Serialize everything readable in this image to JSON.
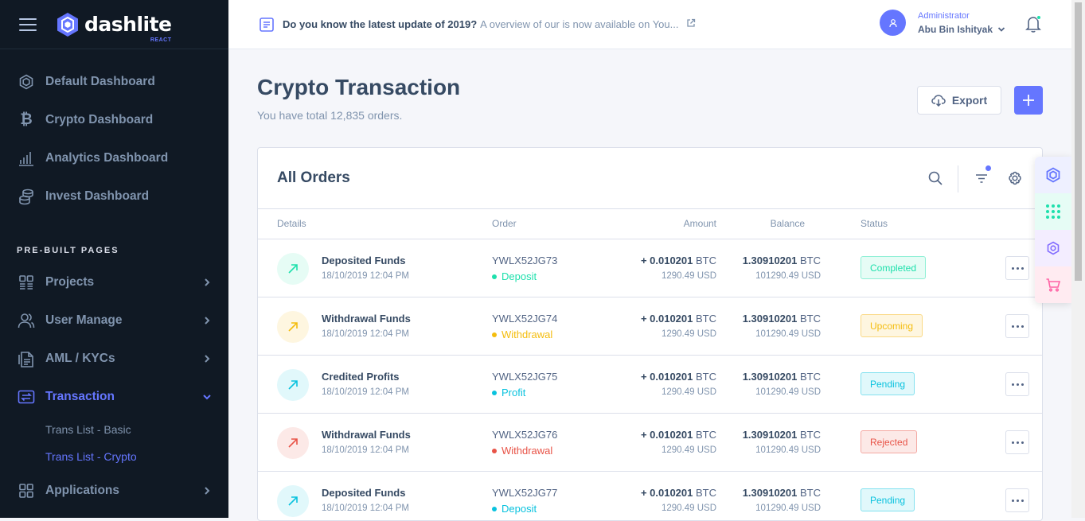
{
  "brand": {
    "name": "dashlite",
    "sub": "REACT"
  },
  "sidebar": {
    "items": [
      {
        "label": "Default Dashboard"
      },
      {
        "label": "Crypto Dashboard"
      },
      {
        "label": "Analytics Dashboard"
      },
      {
        "label": "Invest Dashboard"
      }
    ],
    "heading": "PRE-BUILT PAGES",
    "pages": [
      {
        "label": "Projects"
      },
      {
        "label": "User Manage"
      },
      {
        "label": "AML / KYCs"
      },
      {
        "label": "Transaction"
      },
      {
        "label": "Applications"
      }
    ],
    "sub": [
      {
        "label": "Trans List - Basic"
      },
      {
        "label": "Trans List - Crypto"
      }
    ]
  },
  "header": {
    "news_bold": "Do you know the latest update of 2019?",
    "news_rest": "A overview of our is now available on You...",
    "user_role": "Administrator",
    "user_name": "Abu Bin Ishityak"
  },
  "page": {
    "title": "Crypto Transaction",
    "subtitle": "You have total 12,835 orders.",
    "export_label": "Export"
  },
  "orders": {
    "title": "All Orders",
    "columns": {
      "details": "Details",
      "order": "Order",
      "amount": "Amount",
      "balance": "Balance",
      "status": "Status"
    },
    "rows": [
      {
        "name": "Deposited Funds",
        "date": "18/10/2019 12:04 PM",
        "order": "YWLX52JG73",
        "type": "Deposit",
        "type_color": "#1ee0ac",
        "amount": "+ 0.010201",
        "amount_cur": "BTC",
        "amount_usd": "1290.49 USD",
        "balance": "1.30910201",
        "balance_cur": "BTC",
        "balance_usd": "101290.49 USD",
        "status": "Completed",
        "icon_bg": "#e6fcf5",
        "icon_color": "#1ee0ac",
        "badge_bg": "#e6fcf5",
        "badge_border": "#8ff0d6",
        "badge_color": "#1ee0ac"
      },
      {
        "name": "Withdrawal Funds",
        "date": "18/10/2019 12:04 PM",
        "order": "YWLX52JG74",
        "type": "Withdrawal",
        "type_color": "#f4bd0e",
        "amount": "+ 0.010201",
        "amount_cur": "BTC",
        "amount_usd": "1290.49 USD",
        "balance": "1.30910201",
        "balance_cur": "BTC",
        "balance_usd": "101290.49 USD",
        "status": "Upcoming",
        "icon_bg": "#fef6e0",
        "icon_color": "#f4bd0e",
        "badge_bg": "#fef6e0",
        "badge_border": "#fad985",
        "badge_color": "#f4bd0e"
      },
      {
        "name": "Credited Profits",
        "date": "18/10/2019 12:04 PM",
        "order": "YWLX52JG75",
        "type": "Profit",
        "type_color": "#09c2de",
        "amount": "+ 0.010201",
        "amount_cur": "BTC",
        "amount_usd": "1290.49 USD",
        "balance": "1.30910201",
        "balance_cur": "BTC",
        "balance_usd": "101290.49 USD",
        "status": "Pending",
        "icon_bg": "#e1f8fb",
        "icon_color": "#09c2de",
        "badge_bg": "#e1f8fb",
        "badge_border": "#84e1ef",
        "badge_color": "#09c2de"
      },
      {
        "name": "Withdrawal Funds",
        "date": "18/10/2019 12:04 PM",
        "order": "YWLX52JG76",
        "type": "Withdrawal",
        "type_color": "#e85347",
        "amount": "+ 0.010201",
        "amount_cur": "BTC",
        "amount_usd": "1290.49 USD",
        "balance": "1.30910201",
        "balance_cur": "BTC",
        "balance_usd": "101290.49 USD",
        "status": "Rejected",
        "icon_bg": "#fce9e7",
        "icon_color": "#e85347",
        "badge_bg": "#fce9e7",
        "badge_border": "#f4a9a3",
        "badge_color": "#e85347"
      },
      {
        "name": "Deposited Funds",
        "date": "18/10/2019 12:04 PM",
        "order": "YWLX52JG77",
        "type": "Deposit",
        "type_color": "#09c2de",
        "amount": "+ 0.010201",
        "amount_cur": "BTC",
        "amount_usd": "1290.49 USD",
        "balance": "1.30910201",
        "balance_cur": "BTC",
        "balance_usd": "101290.49 USD",
        "status": "Pending",
        "icon_bg": "#e1f8fb",
        "icon_color": "#09c2de",
        "badge_bg": "#e1f8fb",
        "badge_border": "#84e1ef",
        "badge_color": "#09c2de"
      }
    ]
  },
  "colors": {
    "accent": "#6576ff",
    "sidebar_bg": "#101924"
  }
}
